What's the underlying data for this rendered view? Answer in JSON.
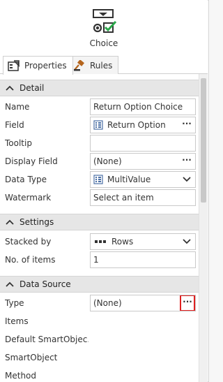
{
  "header": {
    "title": "Choice",
    "icon": "choice-control-icon",
    "accent_color": "#2aa84a"
  },
  "tabs": [
    {
      "label": "Properties",
      "icon": "properties-icon",
      "active": true
    },
    {
      "label": "Rules",
      "icon": "gavel-icon",
      "active": false
    }
  ],
  "sections": {
    "detail": {
      "title": "Detail",
      "name": {
        "label": "Name",
        "value": "Return Option Choice"
      },
      "field": {
        "label": "Field",
        "value": "Return Option"
      },
      "tooltip": {
        "label": "Tooltip",
        "value": ""
      },
      "display_field": {
        "label": "Display Field",
        "value": "(None)"
      },
      "data_type": {
        "label": "Data Type",
        "value": "MultiValue"
      },
      "watermark": {
        "label": "Watermark",
        "value": "Select an item"
      }
    },
    "settings": {
      "title": "Settings",
      "stacked_by": {
        "label": "Stacked by",
        "value": "Rows"
      },
      "no_of_items": {
        "label": "No. of items",
        "value": "1"
      }
    },
    "data_source": {
      "title": "Data Source",
      "type": {
        "label": "Type",
        "value": "(None)"
      },
      "items": {
        "label": "Items"
      },
      "default_smartobject": {
        "label": "Default SmartObjec..."
      },
      "smartobject": {
        "label": "SmartObject"
      },
      "method": {
        "label": "Method"
      }
    }
  },
  "ellipsis_glyph": "···",
  "highlight_color": "#e02020"
}
